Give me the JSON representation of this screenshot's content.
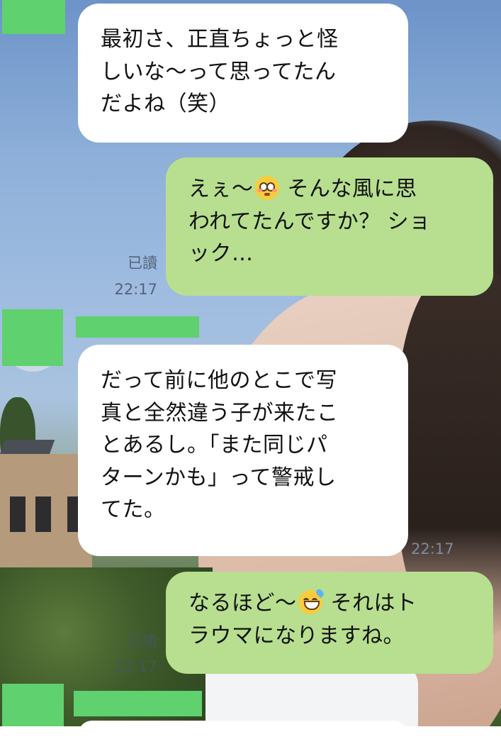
{
  "colors": {
    "incoming_bubble": "#ffffff",
    "outgoing_bubble": "#b7df8f",
    "redaction_block": "#5fd16f",
    "meta_text": "#53637a"
  },
  "messages": [
    {
      "direction": "incoming",
      "lines": [
        "最初さ、正直ちょっと怪",
        "しいな〜って思ってたん",
        "だよね（笑）"
      ]
    },
    {
      "direction": "outgoing",
      "line1_before": "えぇ〜",
      "emoji1": "flushed-face-icon",
      "line1_after": " そんな風に思",
      "lines": [
        "われてたんですか？ ショ",
        "ック…"
      ],
      "read_label": "已讀",
      "time": "22:17"
    },
    {
      "direction": "incoming",
      "lines": [
        "だって前に他のとこで写",
        "真と全然違う子が来たこ",
        "とあるし。「また同じパ",
        "ターンかも」って警戒し",
        "てた。"
      ],
      "time": "22:17"
    },
    {
      "direction": "outgoing",
      "line1_before": "なるほど〜",
      "emoji1": "grinning-sweat-face-icon",
      "line1_after": " それはト",
      "lines": [
        "ラウマになりますね。"
      ],
      "read_label": "已讀",
      "time": "22:17"
    }
  ]
}
